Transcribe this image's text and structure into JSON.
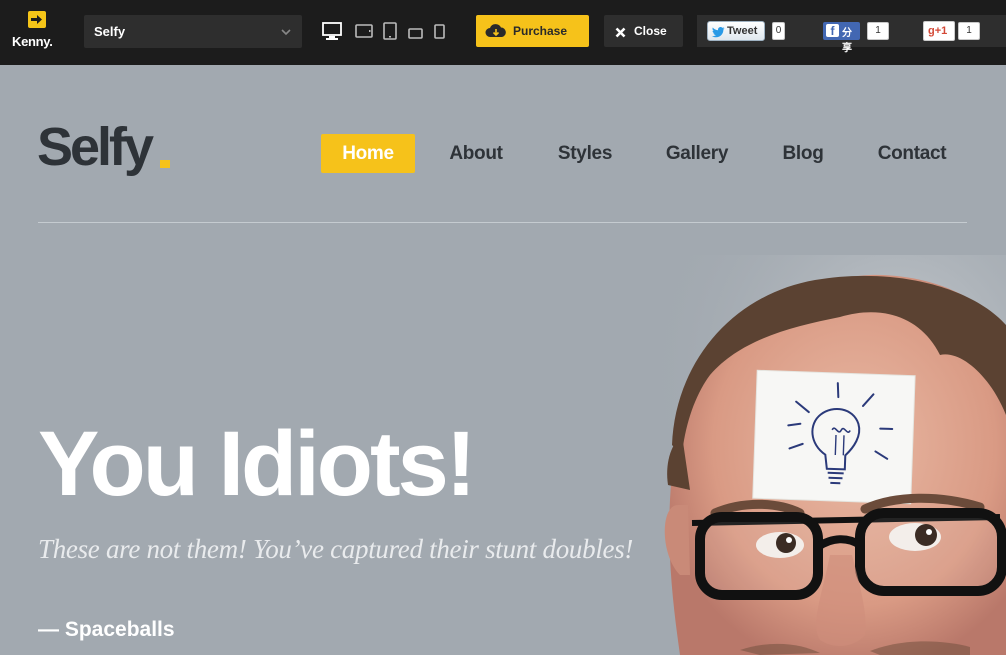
{
  "topbar": {
    "brand": "Kenny.",
    "theme_select_value": "Selfy",
    "devices": [
      "desktop-icon",
      "tablet-landscape-icon",
      "tablet-portrait-icon",
      "phone-landscape-icon",
      "phone-portrait-icon"
    ],
    "purchase_label": "Purchase",
    "close_label": "Close",
    "share": {
      "tweet_label": "Tweet",
      "tweet_count": "0",
      "facebook_label": "分享",
      "facebook_count": "1",
      "gplus_label": "g+1",
      "gplus_count": "1"
    }
  },
  "site": {
    "logo": "Selfy",
    "nav": [
      {
        "label": "Home",
        "active": true
      },
      {
        "label": "About",
        "active": false
      },
      {
        "label": "Styles",
        "active": false
      },
      {
        "label": "Gallery",
        "active": false
      },
      {
        "label": "Blog",
        "active": false
      },
      {
        "label": "Contact",
        "active": false
      }
    ]
  },
  "hero": {
    "title": "You Idiots!",
    "quote": "These are not them! You’ve captured their stunt doubles!",
    "cite": "— Spaceballs"
  },
  "colors": {
    "accent": "#f6c21a",
    "topbar_bg": "#1c1c1c",
    "page_bg": "#a2a9b0",
    "text_dark": "#2e3338"
  }
}
